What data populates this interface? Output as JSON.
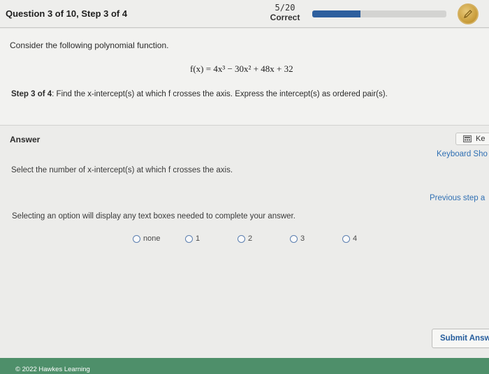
{
  "header": {
    "question_label": "Question 3 of 10, Step 3 of 4",
    "score_value": "5/20",
    "score_label": "Correct",
    "progress_fraction": 0.36,
    "badge_icon": "pencil-medal-icon"
  },
  "question": {
    "intro": "Consider the following polynomial function.",
    "formula": "f(x) = 4x³ − 30x² + 48x + 32",
    "step_label": "Step 3 of 4",
    "step_text": ": Find the x-intercept(s) at which f crosses the axis. Express the intercept(s) as ordered pair(s)."
  },
  "answer": {
    "title": "Answer",
    "select_prompt": "Select the number of x-intercept(s) at which f crosses the axis.",
    "selecting_note": "Selecting an option will display any text boxes needed to complete your answer.",
    "options": [
      "none",
      "1",
      "2",
      "3",
      "4"
    ],
    "keypad_button": "Ke",
    "keyboard_shortcuts_link": "Keyboard Sho",
    "previous_step_link": "Previous step a",
    "submit_button": "Submit Answ"
  },
  "footer": {
    "copyright": "© 2022 Hawkes Learning"
  },
  "colors": {
    "progress": "#2e5f9e",
    "link": "#2f6fb3",
    "footer": "#4e8f6a",
    "badge": "#c79a37"
  }
}
